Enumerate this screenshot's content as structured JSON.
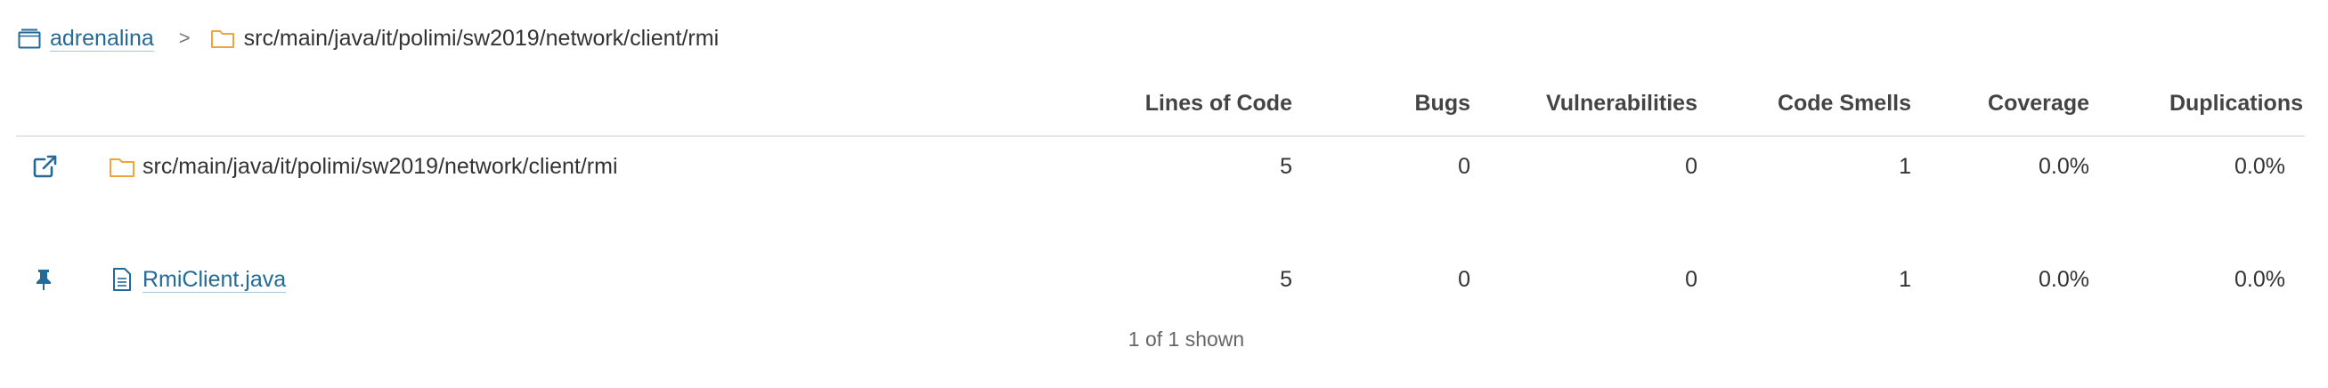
{
  "breadcrumb": {
    "project": "adrenalina",
    "separator": ">",
    "directory": "src/main/java/it/polimi/sw2019/network/client/rmi"
  },
  "table": {
    "columns": [
      "Lines of Code",
      "Bugs",
      "Vulnerabilities",
      "Code Smells",
      "Coverage",
      "Duplications"
    ],
    "rows": [
      {
        "action_icon": "external-link-icon",
        "type_icon": "folder-icon",
        "name": "src/main/java/it/polimi/sw2019/network/client/rmi",
        "lines_of_code": "5",
        "bugs": "0",
        "vulnerabilities": "0",
        "code_smells": "1",
        "coverage": "0.0%",
        "duplications": "0.0%"
      },
      {
        "action_icon": "pin-icon",
        "type_icon": "file-icon",
        "name": "RmiClient.java",
        "lines_of_code": "5",
        "bugs": "0",
        "vulnerabilities": "0",
        "code_smells": "1",
        "coverage": "0.0%",
        "duplications": "0.0%"
      }
    ]
  },
  "footer": {
    "shown_text": "1 of 1 shown"
  },
  "colors": {
    "link": "#236a97",
    "folder": "#f0a43c",
    "text": "#333333",
    "header_border": "#e6e6e6"
  }
}
